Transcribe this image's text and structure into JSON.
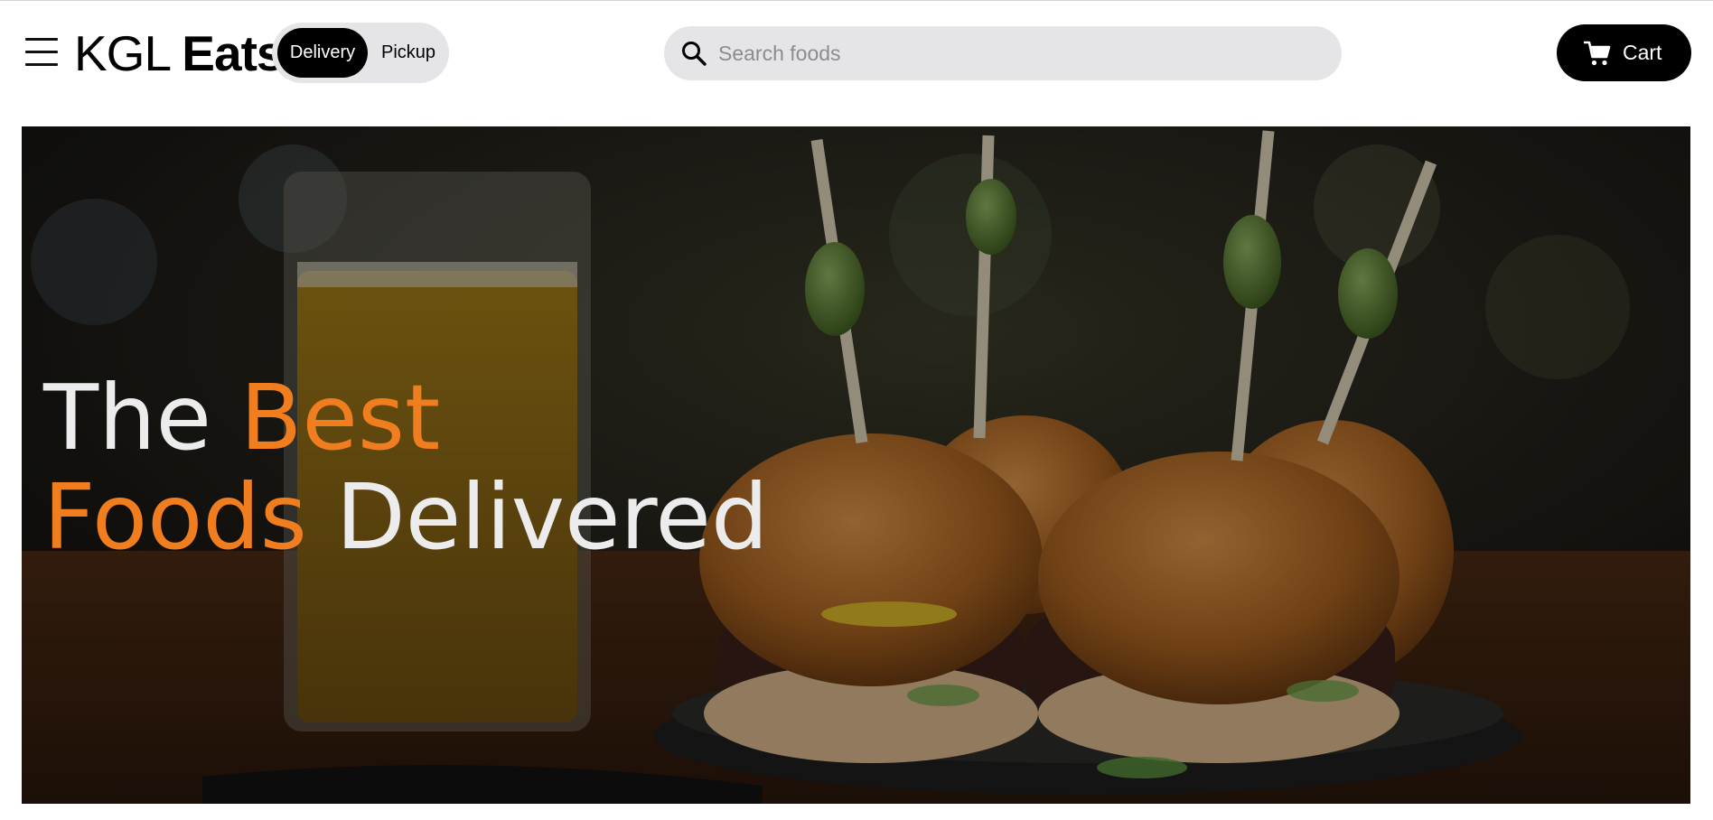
{
  "brand": {
    "name_light": "KGL",
    "name_bold": "Eats"
  },
  "mode_toggle": {
    "options": [
      "Delivery",
      "Pickup"
    ],
    "selected": "Delivery"
  },
  "search": {
    "placeholder": "Search foods",
    "value": ""
  },
  "cart": {
    "label": "Cart"
  },
  "hero": {
    "line1_word1": "The",
    "line1_word2": "Best",
    "line2_word1": "Foods",
    "line2_word2": "Delivered"
  },
  "colors": {
    "accent": "#f07d1e",
    "navbar_bg": "#ffffff",
    "pill_bg": "#e5e5e8",
    "button_dark": "#000000",
    "hero_text": "#ececec"
  },
  "icons": {
    "menu": "hamburger-menu-icon",
    "search": "search-icon",
    "cart": "shopping-cart-icon"
  }
}
